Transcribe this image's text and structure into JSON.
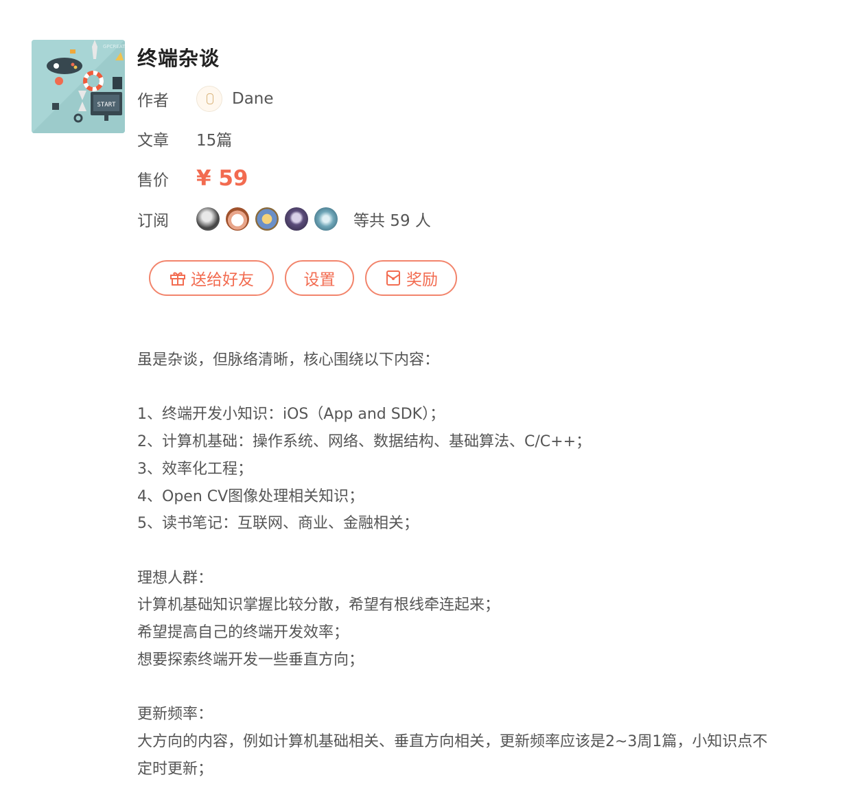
{
  "title": "终端杂谈",
  "cover": {
    "alt": "cover-illustration",
    "start_text": "START",
    "corner_text": "GPCREAT"
  },
  "author": {
    "label": "作者",
    "name": "Dane"
  },
  "articles": {
    "label": "文章",
    "value": "15篇"
  },
  "price": {
    "label": "售价",
    "value": "¥ 59",
    "color": "#f26b50"
  },
  "subscribers": {
    "label": "订阅",
    "summary": "等共 59 人"
  },
  "buttons": {
    "gift": "送给好友",
    "settings": "设置",
    "reward": "奖励"
  },
  "description": [
    "虽是杂谈，但脉络清晰，核心围绕以下内容：",
    "",
    "1、终端开发小知识：iOS（App and SDK）；",
    "2、计算机基础：操作系统、网络、数据结构、基础算法、C/C++；",
    "3、效率化工程；",
    "4、Open CV图像处理相关知识；",
    "5、读书笔记：互联网、商业、金融相关；",
    "",
    "理想人群：",
    "计算机基础知识掌握比较分散，希望有根线牵连起来；",
    "希望提高自己的终端开发效率；",
    "想要探索终端开发一些垂直方向；",
    "",
    "更新频率：",
    "大方向的内容，例如计算机基础相关、垂直方向相关，更新频率应该是2~3周1篇，小知识点不",
    "定时更新；"
  ]
}
